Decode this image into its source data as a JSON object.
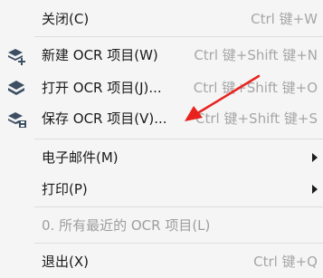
{
  "menu": {
    "items": [
      {
        "label": "关闭(C)",
        "shortcut": "Ctrl 键+W"
      },
      {
        "label": "新建 OCR 项目(W)",
        "shortcut": "Ctrl 键+Shift 键+N",
        "icon": "new-ocr-project-icon"
      },
      {
        "label": "打开 OCR 项目(J)...",
        "shortcut": "Ctrl 键+Shift 键+O",
        "icon": "open-ocr-project-icon"
      },
      {
        "label": "保存 OCR 项目(V)...",
        "shortcut": "Ctrl 键+Shift 键+S",
        "icon": "save-ocr-project-icon"
      },
      {
        "label": "电子邮件(M)",
        "submenu": true
      },
      {
        "label": "打印(P)",
        "submenu": true
      },
      {
        "label": "0. 所有最近的 OCR 项目(L)",
        "disabled": true
      },
      {
        "label": "退出(X)",
        "shortcut": "Ctrl 键+Q"
      }
    ]
  },
  "colors": {
    "background": "#f5f5f5",
    "text": "#1a1a1a",
    "shortcut_text": "#a6a6a6",
    "disabled_text": "#9e9e9e",
    "icon_dark": "#3d4f63",
    "annotation_arrow": "#e8231e"
  }
}
